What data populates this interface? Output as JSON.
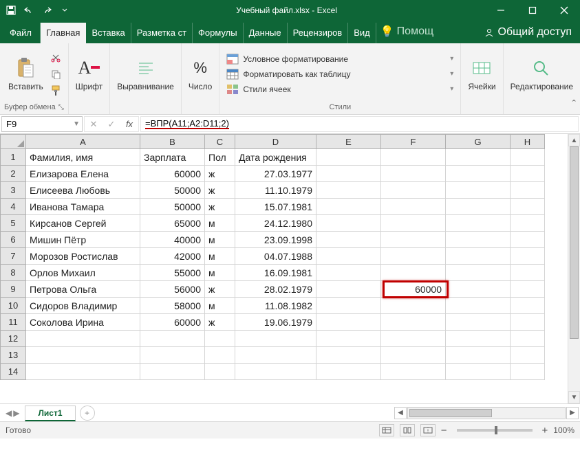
{
  "title": "Учебный файл.xlsx - Excel",
  "tabs": {
    "file": "Файл",
    "home": "Главная",
    "insert": "Вставка",
    "layout": "Разметка ст",
    "formulas": "Формулы",
    "data": "Данные",
    "review": "Рецензиров",
    "view": "Вид",
    "tell": "Помощ",
    "share": "Общий доступ"
  },
  "ribbon": {
    "clipboard": {
      "paste": "Вставить",
      "label": "Буфер обмена"
    },
    "font": {
      "label": "Шрифт"
    },
    "align": {
      "label": "Выравнивание"
    },
    "number": {
      "label": "Число"
    },
    "styles": {
      "cond": "Условное форматирование",
      "table": "Форматировать как таблицу",
      "cell": "Стили ячеек",
      "label": "Стили"
    },
    "cells": {
      "label": "Ячейки"
    },
    "editing": {
      "label": "Редактирование"
    }
  },
  "namebox": "F9",
  "formula": "=ВПР(А11;А2:D11;2)",
  "columns": [
    "A",
    "B",
    "C",
    "D",
    "E",
    "F",
    "G",
    "H"
  ],
  "rows": [
    "1",
    "2",
    "3",
    "4",
    "5",
    "6",
    "7",
    "8",
    "9",
    "10",
    "11",
    "12",
    "13",
    "14"
  ],
  "headers": {
    "A": "Фамилия, имя",
    "B": "Зарплата",
    "C": "Пол",
    "D": "Дата рождения"
  },
  "data": [
    {
      "name": "Елизарова Елена",
      "salary": "60000",
      "sex": "ж",
      "dob": "27.03.1977"
    },
    {
      "name": "Елисеева Любовь",
      "salary": "50000",
      "sex": "ж",
      "dob": "11.10.1979"
    },
    {
      "name": "Иванова Тамара",
      "salary": "50000",
      "sex": "ж",
      "dob": "15.07.1981"
    },
    {
      "name": "Кирсанов Сергей",
      "salary": "65000",
      "sex": "м",
      "dob": "24.12.1980"
    },
    {
      "name": "Мишин Пётр",
      "salary": "40000",
      "sex": "м",
      "dob": "23.09.1998"
    },
    {
      "name": "Морозов Ростислав",
      "salary": "42000",
      "sex": "м",
      "dob": "04.07.1988"
    },
    {
      "name": "Орлов Михаил",
      "salary": "55000",
      "sex": "м",
      "dob": "16.09.1981"
    },
    {
      "name": "Петрова Ольга",
      "salary": "56000",
      "sex": "ж",
      "dob": "28.02.1979"
    },
    {
      "name": "Сидоров Владимир",
      "salary": "58000",
      "sex": "м",
      "dob": "11.08.1982"
    },
    {
      "name": "Соколова Ирина",
      "salary": "60000",
      "sex": "ж",
      "dob": "19.06.1979"
    }
  ],
  "result_cell": "60000",
  "sheet": "Лист1",
  "status": "Готово",
  "zoom": "100%"
}
